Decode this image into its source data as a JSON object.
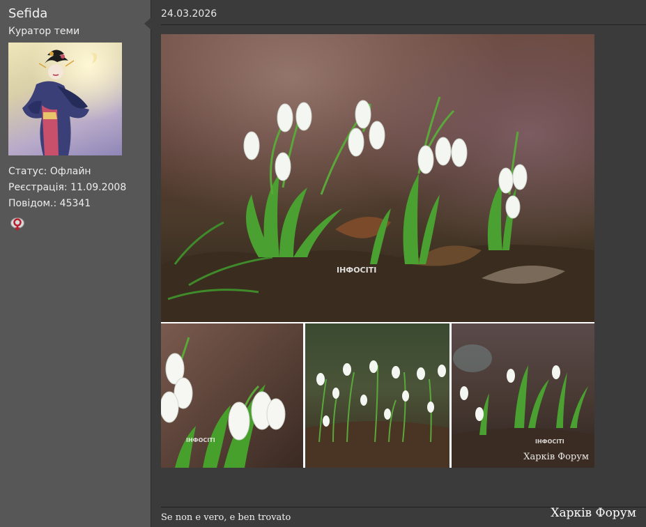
{
  "sidebar": {
    "username": "Sefida",
    "role": "Куратор теми",
    "status": "Статус: Офлайн",
    "registration": "Реєстрація: 11.09.2008",
    "posts": "Повідом.: 45341",
    "gender_icon": "female-symbol-icon",
    "avatar": "geisha-illustration"
  },
  "post": {
    "date": "24.03.2026",
    "watermark_main": "ІНФОСІТІ",
    "watermark_small": "ІНФОСІТІ",
    "watermark_c": "ІНФОСІТІ",
    "photo_signature": "Харків Форум",
    "signature": "Se non e vero, e ben trovato"
  },
  "footer": {
    "forum_watermark": "Харків Форум"
  },
  "colors": {
    "sidebar_bg": "#575757",
    "main_bg": "#3b3b3b",
    "text": "#ededed"
  }
}
